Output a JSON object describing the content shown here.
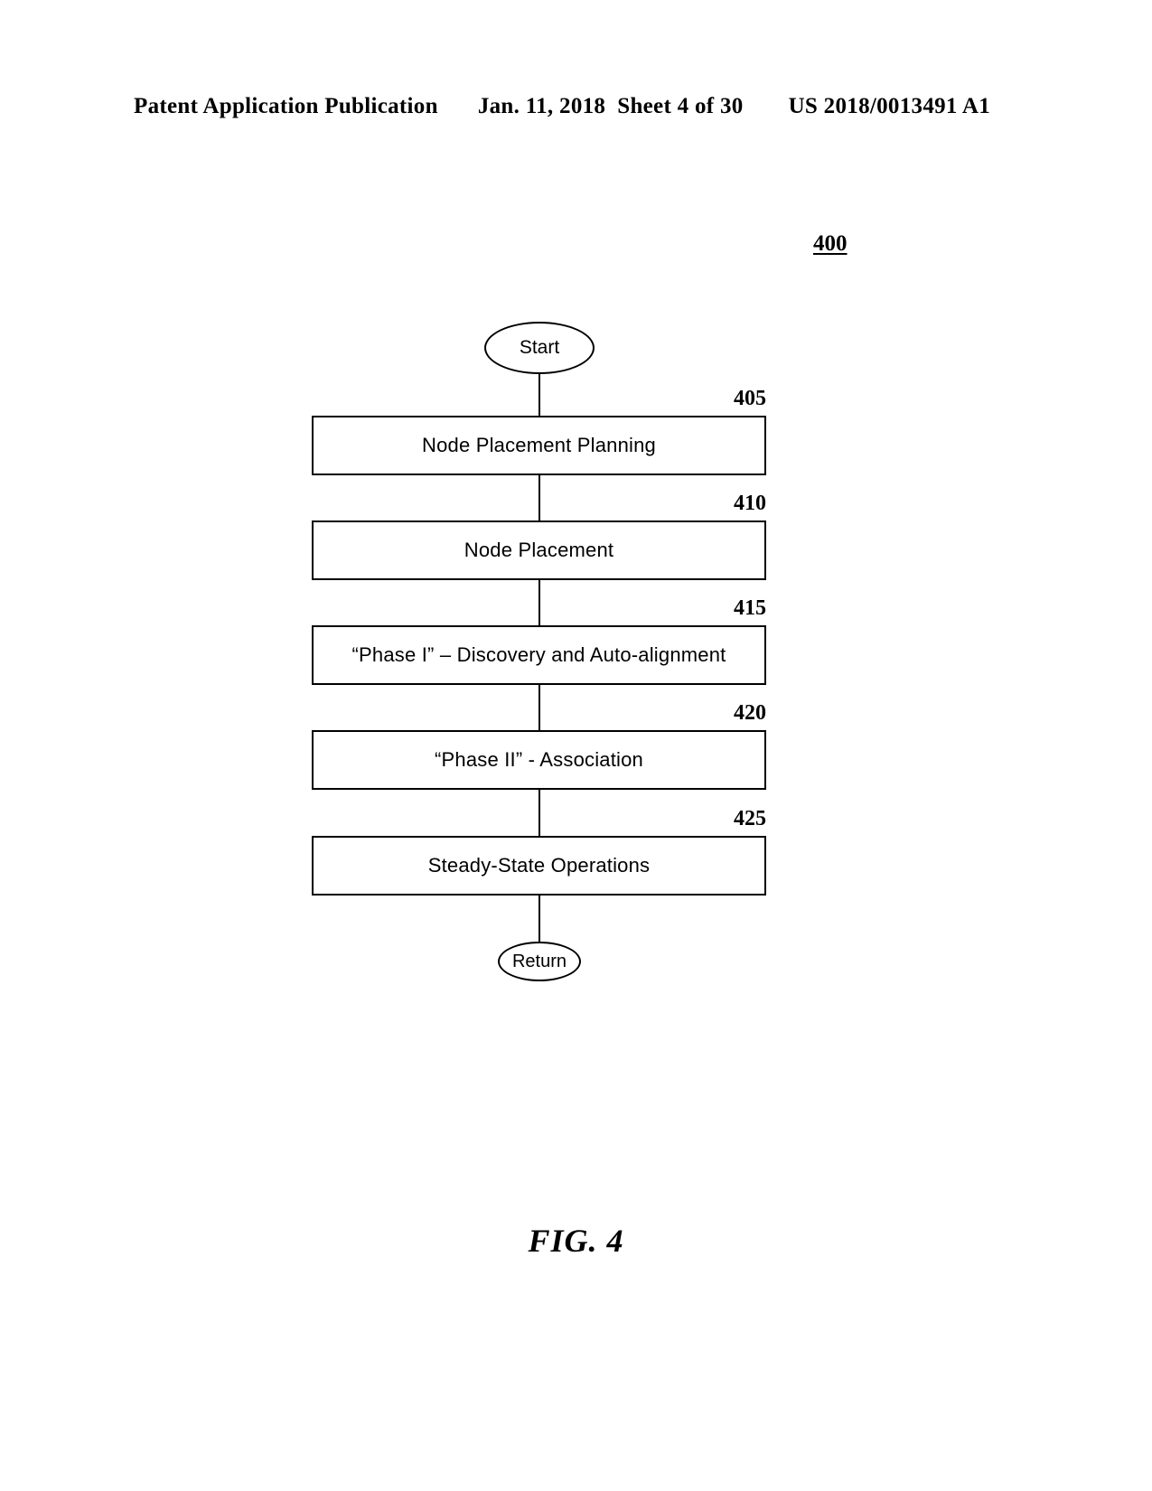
{
  "header": {
    "publication": "Patent Application Publication",
    "date": "Jan. 11, 2018",
    "sheet": "Sheet 4 of 30",
    "patent_number": "US 2018/0013491 A1"
  },
  "figure": {
    "reference_label": "400",
    "caption": "FIG. 4",
    "type": "flowchart",
    "start_label": "Start",
    "end_label": "Return",
    "steps": [
      {
        "ref": "405",
        "label": "Node Placement Planning"
      },
      {
        "ref": "410",
        "label": "Node Placement"
      },
      {
        "ref": "415",
        "label": "“Phase I” – Discovery and Auto-alignment"
      },
      {
        "ref": "420",
        "label": "“Phase II” - Association"
      },
      {
        "ref": "425",
        "label": "Steady-State Operations"
      }
    ]
  },
  "colors": {
    "ink": "#000000",
    "paper": "#ffffff"
  }
}
